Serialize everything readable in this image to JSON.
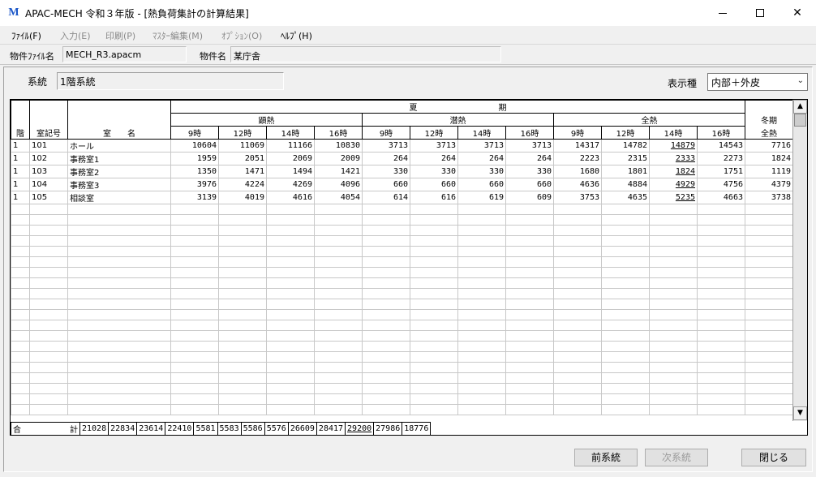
{
  "window": {
    "app_icon": "M",
    "title": "APAC-MECH 令和３年版 - [熱負荷集計の計算結果]",
    "min_icon": "minimize-icon",
    "max_icon": "maximize-icon",
    "close_glyph": "✕"
  },
  "menu": [
    {
      "label": "ﾌｧｲﾙ(F)",
      "enabled": true
    },
    {
      "label": "入力(E)",
      "enabled": false
    },
    {
      "label": "印刷(P)",
      "enabled": false
    },
    {
      "label": "ﾏｽﾀｰ編集(M)",
      "enabled": false
    },
    {
      "label": "ｵﾌﾟｼｮﾝ(O)",
      "enabled": false
    },
    {
      "label": "ﾍﾙﾌﾟ(H)",
      "enabled": true
    }
  ],
  "file": {
    "file_label": "物件ﾌｧｲﾙ名",
    "file_value": "MECH_R3.apacm",
    "name_label": "物件名",
    "name_value": "某庁舎"
  },
  "system": {
    "label": "系統",
    "value": "1階系統"
  },
  "display": {
    "label": "表示種",
    "selected": "内部＋外皮"
  },
  "table": {
    "col_floor": "階",
    "col_room_no": "室記号",
    "col_room_name": "室　　名",
    "summer": "夏　　　　　　　　　　期",
    "sensible": "顕熱",
    "latent": "潜熱",
    "total": "全熱",
    "winter_top": "冬期",
    "winter_bottom": "全熱",
    "hours": [
      "9時",
      "12時",
      "14時",
      "16時"
    ],
    "rows": [
      {
        "floor": "1",
        "room_no": "101",
        "name": "ホール",
        "values": [
          "10604",
          "11069",
          "11166",
          "10830",
          "3713",
          "3713",
          "3713",
          "3713",
          "14317",
          "14782",
          "14879",
          "14543",
          "7716"
        ]
      },
      {
        "floor": "1",
        "room_no": "102",
        "name": "事務室1",
        "values": [
          "1959",
          "2051",
          "2069",
          "2009",
          "264",
          "264",
          "264",
          "264",
          "2223",
          "2315",
          "2333",
          "2273",
          "1824"
        ]
      },
      {
        "floor": "1",
        "room_no": "103",
        "name": "事務室2",
        "values": [
          "1350",
          "1471",
          "1494",
          "1421",
          "330",
          "330",
          "330",
          "330",
          "1680",
          "1801",
          "1824",
          "1751",
          "1119"
        ]
      },
      {
        "floor": "1",
        "room_no": "104",
        "name": "事務室3",
        "values": [
          "3976",
          "4224",
          "4269",
          "4096",
          "660",
          "660",
          "660",
          "660",
          "4636",
          "4884",
          "4929",
          "4756",
          "4379"
        ]
      },
      {
        "floor": "1",
        "room_no": "105",
        "name": "相談室",
        "values": [
          "3139",
          "4019",
          "4616",
          "4054",
          "614",
          "616",
          "619",
          "609",
          "3753",
          "4635",
          "5235",
          "4663",
          "3738"
        ]
      }
    ],
    "total_label_1": "合",
    "total_label_2": "計",
    "totals": [
      "21028",
      "22834",
      "23614",
      "22410",
      "5581",
      "5583",
      "5586",
      "5576",
      "26609",
      "28417",
      "29200",
      "27986",
      "18776"
    ]
  },
  "buttons": {
    "prev": "前系統",
    "next": "次系統",
    "close": "閉じる"
  },
  "scroll": {
    "up_glyph": "▲",
    "down_glyph": "▼"
  }
}
